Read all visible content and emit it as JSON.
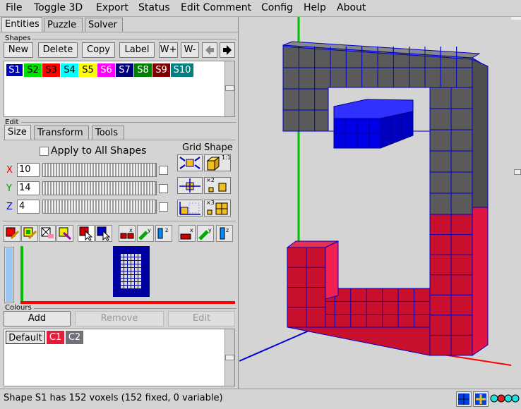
{
  "menu": [
    "File",
    "Toggle 3D",
    "Export",
    "Status",
    "Edit Comment",
    "Config",
    "Help",
    "About"
  ],
  "tabs": [
    "Entities",
    "Puzzle",
    "Solver"
  ],
  "shapes": {
    "group_label": "Shapes",
    "buttons": [
      "New",
      "Delete",
      "Copy",
      "Label",
      "W+",
      "W-"
    ],
    "list": [
      {
        "label": "S1",
        "color": "#0000c0",
        "fg": "#ffffff",
        "selected": true
      },
      {
        "label": "S2",
        "color": "#00e000",
        "fg": "#000000"
      },
      {
        "label": "S3",
        "color": "#ff0000",
        "fg": "#000000"
      },
      {
        "label": "S4",
        "color": "#00ffff",
        "fg": "#000000"
      },
      {
        "label": "S5",
        "color": "#ffff00",
        "fg": "#000000"
      },
      {
        "label": "S6",
        "color": "#ff00ff",
        "fg": "#ffffff"
      },
      {
        "label": "S7",
        "color": "#00007f",
        "fg": "#ffffff"
      },
      {
        "label": "S8",
        "color": "#008000",
        "fg": "#ffffff"
      },
      {
        "label": "S9",
        "color": "#800000",
        "fg": "#ffffff"
      },
      {
        "label": "S10",
        "color": "#008080",
        "fg": "#ffffff"
      }
    ]
  },
  "edit": {
    "group_label": "Edit",
    "subtabs": [
      "Size",
      "Transform",
      "Tools"
    ],
    "apply_all": "Apply to All Shapes",
    "grid_label": "Grid",
    "shape_label": "Shape",
    "dims": [
      {
        "axis": "X",
        "value": "10",
        "color": "#e00000"
      },
      {
        "axis": "Y",
        "value": "14",
        "color": "#00a000"
      },
      {
        "axis": "Z",
        "value": "4",
        "color": "#0000e0"
      }
    ],
    "icon_labels": [
      "1:1",
      "×2",
      "×3"
    ]
  },
  "colours": {
    "group_label": "Colours",
    "buttons": [
      "Add",
      "Remove",
      "Edit"
    ],
    "list": [
      {
        "label": "Default",
        "color": "#e4e4e4",
        "fg": "#000000",
        "selected": true
      },
      {
        "label": "C1",
        "color": "#e0203a",
        "fg": "#ffffff"
      },
      {
        "label": "C2",
        "color": "#707078",
        "fg": "#ffffff"
      }
    ]
  },
  "status": "Shape S1 has 152 voxels (152 fixed, 0 variable)",
  "icons": [
    "color-pen-icon",
    "varpen-icon",
    "eraser-icon",
    "brush-icon",
    "select-icon",
    "select-group-icon",
    "mirror-x-icon",
    "mirror-y-icon",
    "mirror-z-icon",
    "column-x-icon",
    "column-y-icon",
    "column-z-icon"
  ],
  "colors": {
    "frame_red": "#c8102e",
    "frame_grey": "#5a5a5a",
    "piece_blue": "#0000e0",
    "bg": "#d4d4d4"
  }
}
